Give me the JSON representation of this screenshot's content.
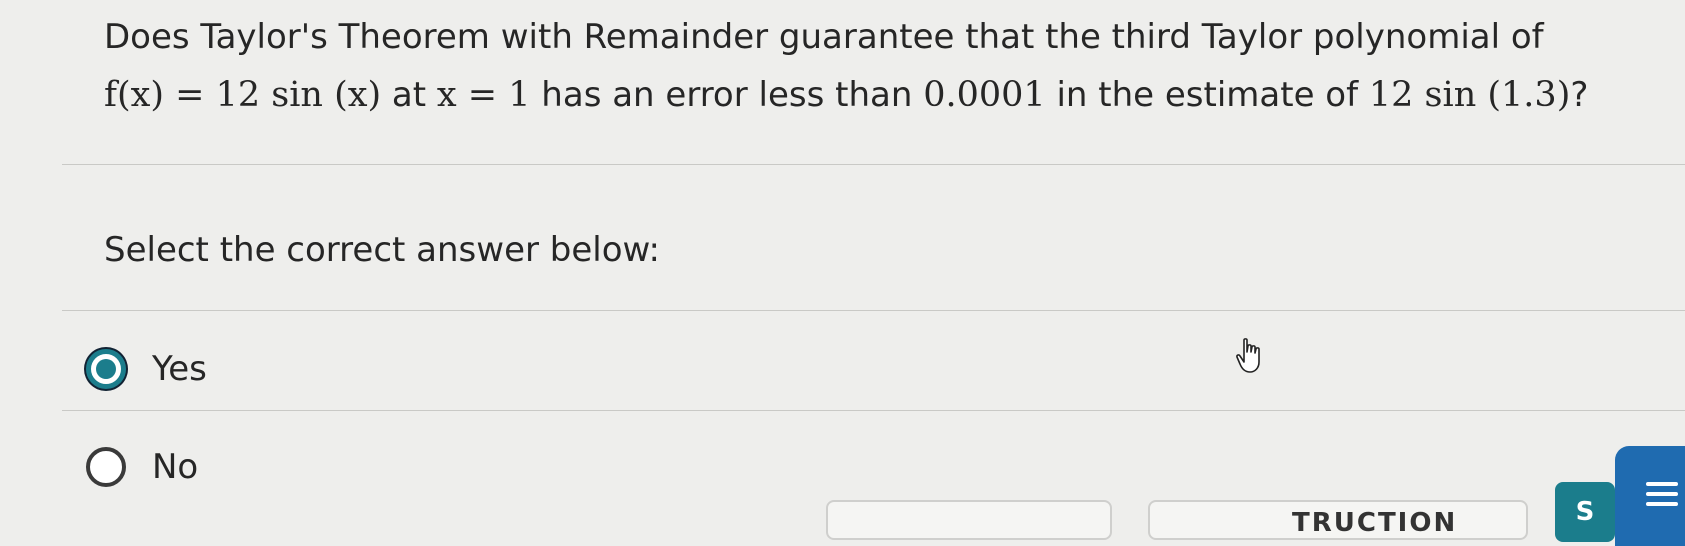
{
  "question": {
    "line1": "Does Taylor's Theorem with Remainder guarantee that the third Taylor polynomial of",
    "fx": "f(x) = 12 sin (x)",
    "at_text": " at ",
    "xeq": "x = 1",
    "mid_text": " has an error less than ",
    "error": "0.0001",
    "estimate_text": " in the estimate of ",
    "estimate": "12 sin (1.3)",
    "end": "?"
  },
  "prompt": "Select the correct answer below:",
  "options": [
    {
      "label": "Yes",
      "selected": true
    },
    {
      "label": "No",
      "selected": false
    }
  ],
  "footer": {
    "partial_button_text": "TRUCTION",
    "teal_button_text": "S"
  },
  "colors": {
    "accent": "#1b7d8c",
    "menu_button": "#1f6bb0"
  },
  "icons": {
    "cursor": "hand-pointer-icon",
    "menu": "menu-icon"
  }
}
